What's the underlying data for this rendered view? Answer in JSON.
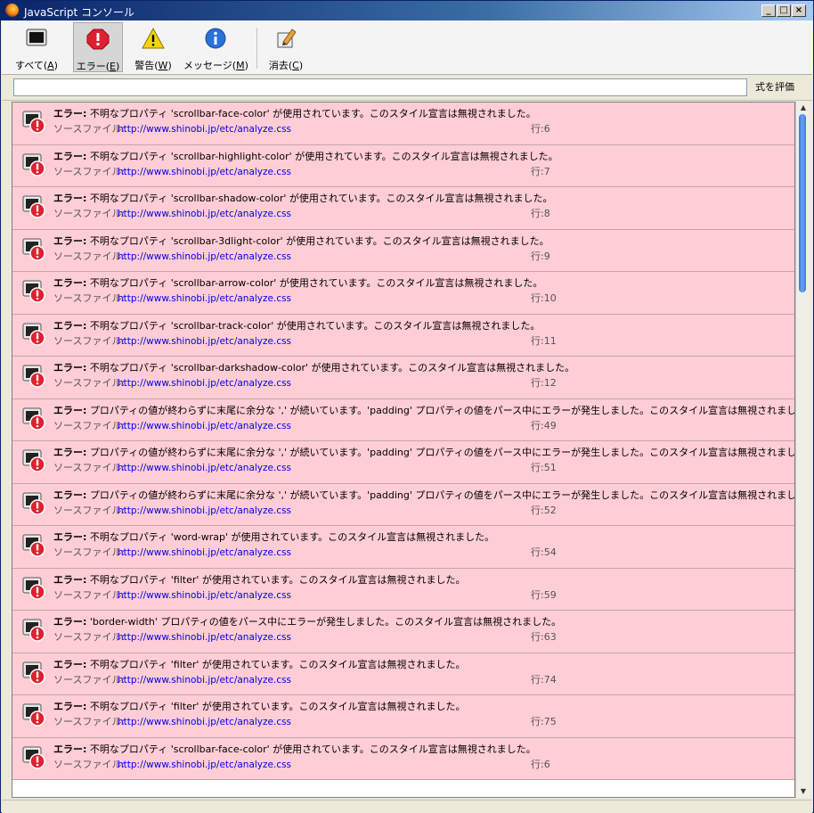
{
  "window": {
    "title": "JavaScript コンソール"
  },
  "toolbar": {
    "buttons": [
      {
        "label": "すべて(",
        "key": "A",
        "suffix": ")"
      },
      {
        "label": "エラー(",
        "key": "E",
        "suffix": ")"
      },
      {
        "label": "警告(",
        "key": "W",
        "suffix": ")"
      },
      {
        "label": "メッセージ(",
        "key": "M",
        "suffix": ")"
      },
      {
        "label": "消去(",
        "key": "C",
        "suffix": ")"
      }
    ]
  },
  "eval": {
    "value": "",
    "button": "式を評価"
  },
  "labels": {
    "error": "エラー:",
    "source": "ソースファイル:"
  },
  "entries": [
    {
      "msg": "不明なプロパティ 'scrollbar-face-color' が使用されています。このスタイル宣言は無視されました。",
      "file": "http://www.shinobi.jp/etc/analyze.css",
      "line": "行:6"
    },
    {
      "msg": "不明なプロパティ 'scrollbar-highlight-color' が使用されています。このスタイル宣言は無視されました。",
      "file": "http://www.shinobi.jp/etc/analyze.css",
      "line": "行:7"
    },
    {
      "msg": "不明なプロパティ 'scrollbar-shadow-color' が使用されています。このスタイル宣言は無視されました。",
      "file": "http://www.shinobi.jp/etc/analyze.css",
      "line": "行:8"
    },
    {
      "msg": "不明なプロパティ 'scrollbar-3dlight-color' が使用されています。このスタイル宣言は無視されました。",
      "file": "http://www.shinobi.jp/etc/analyze.css",
      "line": "行:9"
    },
    {
      "msg": "不明なプロパティ 'scrollbar-arrow-color' が使用されています。このスタイル宣言は無視されました。",
      "file": "http://www.shinobi.jp/etc/analyze.css",
      "line": "行:10"
    },
    {
      "msg": "不明なプロパティ 'scrollbar-track-color' が使用されています。このスタイル宣言は無視されました。",
      "file": "http://www.shinobi.jp/etc/analyze.css",
      "line": "行:11"
    },
    {
      "msg": "不明なプロパティ 'scrollbar-darkshadow-color' が使用されています。このスタイル宣言は無視されました。",
      "file": "http://www.shinobi.jp/etc/analyze.css",
      "line": "行:12"
    },
    {
      "msg": "プロパティの値が終わらずに末尾に余分な ',' が続いています。'padding' プロパティの値をパース中にエラーが発生しました。このスタイル宣言は無視されました。",
      "file": "http://www.shinobi.jp/etc/analyze.css",
      "line": "行:49"
    },
    {
      "msg": "プロパティの値が終わらずに末尾に余分な ',' が続いています。'padding' プロパティの値をパース中にエラーが発生しました。このスタイル宣言は無視されました。",
      "file": "http://www.shinobi.jp/etc/analyze.css",
      "line": "行:51"
    },
    {
      "msg": "プロパティの値が終わらずに末尾に余分な ',' が続いています。'padding' プロパティの値をパース中にエラーが発生しました。このスタイル宣言は無視されました。",
      "file": "http://www.shinobi.jp/etc/analyze.css",
      "line": "行:52"
    },
    {
      "msg": "不明なプロパティ 'word-wrap' が使用されています。このスタイル宣言は無視されました。",
      "file": "http://www.shinobi.jp/etc/analyze.css",
      "line": "行:54"
    },
    {
      "msg": "不明なプロパティ 'filter' が使用されています。このスタイル宣言は無視されました。",
      "file": "http://www.shinobi.jp/etc/analyze.css",
      "line": "行:59"
    },
    {
      "msg": "'border-width' プロパティの値をパース中にエラーが発生しました。このスタイル宣言は無視されました。",
      "file": "http://www.shinobi.jp/etc/analyze.css",
      "line": "行:63"
    },
    {
      "msg": "不明なプロパティ 'filter' が使用されています。このスタイル宣言は無視されました。",
      "file": "http://www.shinobi.jp/etc/analyze.css",
      "line": "行:74"
    },
    {
      "msg": "不明なプロパティ 'filter' が使用されています。このスタイル宣言は無視されました。",
      "file": "http://www.shinobi.jp/etc/analyze.css",
      "line": "行:75"
    },
    {
      "msg": "不明なプロパティ 'scrollbar-face-color' が使用されています。このスタイル宣言は無視されました。",
      "file": "http://www.shinobi.jp/etc/analyze.css",
      "line": "行:6"
    }
  ],
  "icons": {
    "titlebar": "firefox-icon",
    "all": "console-all-icon",
    "error": "error-icon",
    "warning": "warning-icon",
    "message": "info-icon",
    "clear": "clear-icon",
    "entry": "entry-error-icon"
  },
  "colors": {
    "entry_bg": "#ffcdd5",
    "link": "#0000ee",
    "title_bar": "#0a246a"
  }
}
